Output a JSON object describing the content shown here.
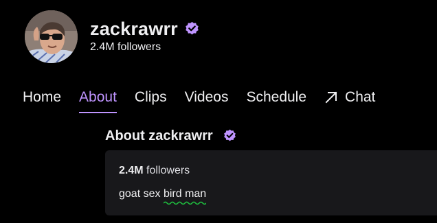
{
  "channel": {
    "name": "zackrawrr",
    "followers": "2.4M followers",
    "verified_icon": "verified-badge-icon",
    "verified_color": "#9147ff"
  },
  "nav": {
    "items": [
      {
        "label": "Home"
      },
      {
        "label": "About"
      },
      {
        "label": "Clips"
      },
      {
        "label": "Videos"
      },
      {
        "label": "Schedule"
      },
      {
        "label": "Chat",
        "icon": "external-arrow-icon"
      }
    ],
    "active": "About",
    "accent_color": "#bf94ff"
  },
  "about": {
    "title": "About zackrawrr",
    "followers_count": "2.4M",
    "followers_label": "followers",
    "bio_prefix": "goat sex ",
    "bio_underlined": "bird man",
    "spellcheck_underline_color": "#1fbf3f"
  }
}
